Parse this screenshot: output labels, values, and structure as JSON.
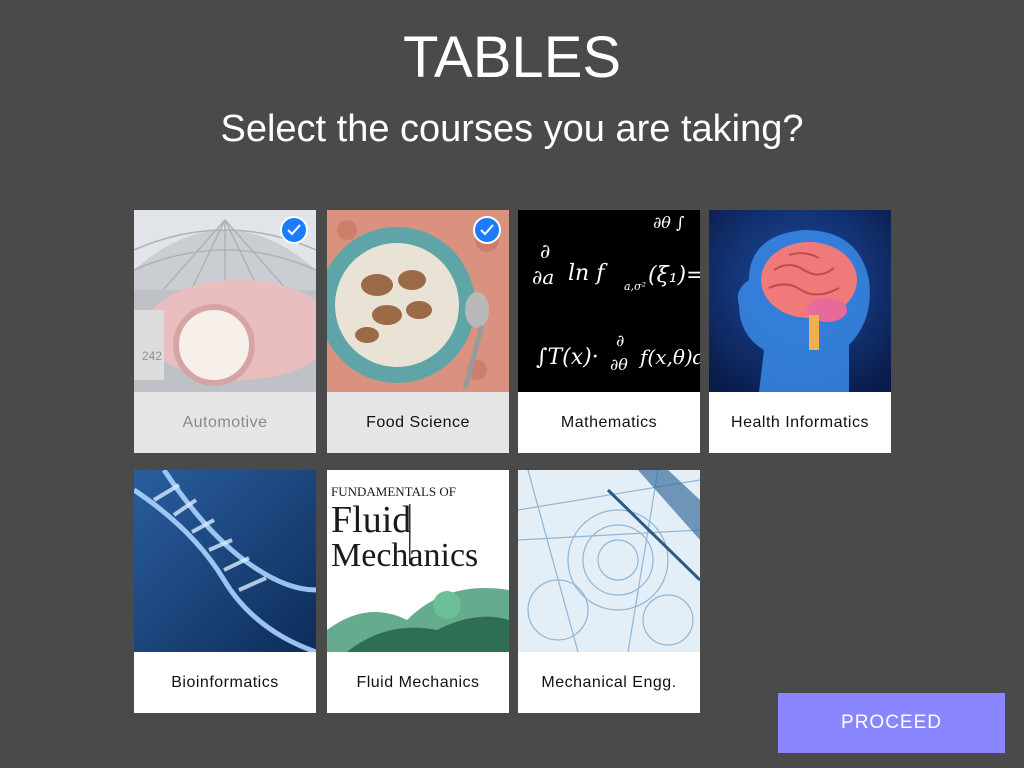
{
  "header": {
    "title": "TABLES",
    "subtitle": "Select the courses you are taking?"
  },
  "courses": [
    {
      "label": "Automotive",
      "selected": true
    },
    {
      "label": "Food Science",
      "selected": true
    },
    {
      "label": "Mathematics",
      "selected": false
    },
    {
      "label": "Health Informatics",
      "selected": false
    },
    {
      "label": "Bioinformatics",
      "selected": false
    },
    {
      "label": "Fluid Mechanics",
      "selected": false
    },
    {
      "label": "Mechanical Engg.",
      "selected": false
    }
  ],
  "math_thumb": {
    "line1": "∂θ ∫",
    "line2": "∂",
    "line3": "∂a",
    "line4": "ln f",
    "line5": "a,σ²",
    "line6": "(ξ₁)=",
    "line7": "∫T(x)·",
    "line8": "∂",
    "line9": "∂θ",
    "line10": "f(x,θ)d"
  },
  "fluid_thumb": {
    "line1": "FUNDAMENTALS OF",
    "line2": "Fluid",
    "line3": "Mechanics"
  },
  "actions": {
    "proceed_label": "PROCEED"
  },
  "colors": {
    "background": "#4a4a4a",
    "check": "#1a7cff",
    "proceed": "#8a86ff"
  }
}
